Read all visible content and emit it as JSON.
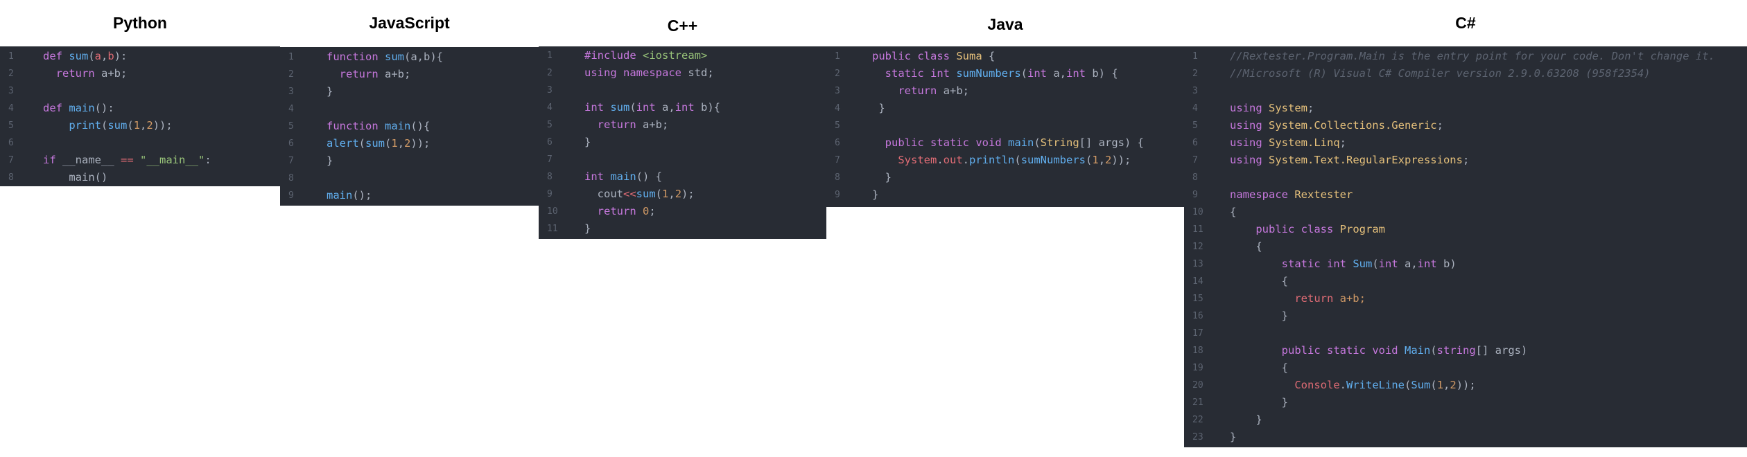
{
  "panels": [
    {
      "title": "Python",
      "lines": [
        {
          "n": "1",
          "tokens": [
            [
              "def ",
              "kw"
            ],
            [
              "sum",
              "fn"
            ],
            [
              "(",
              "pl"
            ],
            [
              "a",
              "var"
            ],
            [
              ",",
              "pl"
            ],
            [
              "b",
              "var"
            ],
            [
              "):",
              "pl"
            ]
          ]
        },
        {
          "n": "2",
          "tokens": [
            [
              "  return ",
              "kw"
            ],
            [
              "a+b;",
              "pl"
            ]
          ]
        },
        {
          "n": "3",
          "tokens": []
        },
        {
          "n": "4",
          "tokens": [
            [
              "def ",
              "kw"
            ],
            [
              "main",
              "fn"
            ],
            [
              "():",
              "pl"
            ]
          ]
        },
        {
          "n": "5",
          "tokens": [
            [
              "    ",
              "pl"
            ],
            [
              "print",
              "fn"
            ],
            [
              "(",
              "pl"
            ],
            [
              "sum",
              "fn"
            ],
            [
              "(",
              "pl"
            ],
            [
              "1",
              "num"
            ],
            [
              ",",
              "pl"
            ],
            [
              "2",
              "num"
            ],
            [
              "));",
              "pl"
            ]
          ]
        },
        {
          "n": "6",
          "tokens": []
        },
        {
          "n": "7",
          "tokens": [
            [
              "if ",
              "kw"
            ],
            [
              "__name__ ",
              "pl"
            ],
            [
              "== ",
              "var"
            ],
            [
              "\"__main__\"",
              "str"
            ],
            [
              ":",
              "pl"
            ]
          ]
        },
        {
          "n": "8",
          "tokens": [
            [
              "    main()",
              "pl"
            ]
          ]
        }
      ]
    },
    {
      "title": "JavaScript",
      "lines": [
        {
          "n": "1",
          "tokens": [
            [
              "function ",
              "kw"
            ],
            [
              "sum",
              "fn"
            ],
            [
              "(a,b){",
              "pl"
            ]
          ]
        },
        {
          "n": "2",
          "tokens": [
            [
              "  return ",
              "kw"
            ],
            [
              "a+b;",
              "pl"
            ]
          ]
        },
        {
          "n": "3",
          "tokens": [
            [
              "}",
              "pl"
            ]
          ]
        },
        {
          "n": "4",
          "tokens": []
        },
        {
          "n": "5",
          "tokens": [
            [
              "function ",
              "kw"
            ],
            [
              "main",
              "fn"
            ],
            [
              "(){",
              "pl"
            ]
          ]
        },
        {
          "n": "6",
          "tokens": [
            [
              "alert",
              "fn"
            ],
            [
              "(",
              "pl"
            ],
            [
              "sum",
              "fn"
            ],
            [
              "(",
              "pl"
            ],
            [
              "1",
              "num"
            ],
            [
              ",",
              "pl"
            ],
            [
              "2",
              "num"
            ],
            [
              "));",
              "pl"
            ]
          ]
        },
        {
          "n": "7",
          "tokens": [
            [
              "}",
              "pl"
            ]
          ]
        },
        {
          "n": "8",
          "tokens": []
        },
        {
          "n": "9",
          "tokens": [
            [
              "main",
              "fn"
            ],
            [
              "();",
              "pl"
            ]
          ]
        }
      ]
    },
    {
      "title": "C++",
      "lines": [
        {
          "n": "1",
          "tokens": [
            [
              "#include ",
              "kw"
            ],
            [
              "<iostream>",
              "str"
            ]
          ]
        },
        {
          "n": "2",
          "tokens": [
            [
              "using ",
              "kw"
            ],
            [
              "namespace ",
              "kw"
            ],
            [
              "std;",
              "pl"
            ]
          ]
        },
        {
          "n": "3",
          "tokens": []
        },
        {
          "n": "4",
          "tokens": [
            [
              "int ",
              "kw"
            ],
            [
              "sum",
              "fn"
            ],
            [
              "(",
              "pl"
            ],
            [
              "int ",
              "kw"
            ],
            [
              "a,",
              "pl"
            ],
            [
              "int ",
              "kw"
            ],
            [
              "b){",
              "pl"
            ]
          ]
        },
        {
          "n": "5",
          "tokens": [
            [
              "  return ",
              "kw"
            ],
            [
              "a+b;",
              "pl"
            ]
          ]
        },
        {
          "n": "6",
          "tokens": [
            [
              "}",
              "pl"
            ]
          ]
        },
        {
          "n": "7",
          "tokens": []
        },
        {
          "n": "8",
          "tokens": [
            [
              "int ",
              "kw"
            ],
            [
              "main",
              "fn"
            ],
            [
              "() {",
              "pl"
            ]
          ]
        },
        {
          "n": "9",
          "tokens": [
            [
              "  cout",
              "pl"
            ],
            [
              "<<",
              "var"
            ],
            [
              "sum",
              "fn"
            ],
            [
              "(",
              "pl"
            ],
            [
              "1",
              "num"
            ],
            [
              ",",
              "pl"
            ],
            [
              "2",
              "num"
            ],
            [
              ");",
              "pl"
            ]
          ]
        },
        {
          "n": "10",
          "tokens": [
            [
              "  return ",
              "kw"
            ],
            [
              "0",
              "num"
            ],
            [
              ";",
              "pl"
            ]
          ]
        },
        {
          "n": "11",
          "tokens": [
            [
              "}",
              "pl"
            ]
          ]
        }
      ]
    },
    {
      "title": "Java",
      "lines": [
        {
          "n": "1",
          "tokens": [
            [
              "public ",
              "kw"
            ],
            [
              "class ",
              "kw"
            ],
            [
              "Suma ",
              "cls"
            ],
            [
              "{",
              "pl"
            ]
          ]
        },
        {
          "n": "2",
          "tokens": [
            [
              "  static ",
              "kw"
            ],
            [
              "int ",
              "kw"
            ],
            [
              "sumNumbers",
              "fn"
            ],
            [
              "(",
              "pl"
            ],
            [
              "int ",
              "kw"
            ],
            [
              "a,",
              "pl"
            ],
            [
              "int ",
              "kw"
            ],
            [
              "b) {",
              "pl"
            ]
          ]
        },
        {
          "n": "3",
          "tokens": [
            [
              "    return ",
              "kw"
            ],
            [
              "a+b;",
              "pl"
            ]
          ]
        },
        {
          "n": "4",
          "tokens": [
            [
              " }",
              "pl"
            ]
          ]
        },
        {
          "n": "5",
          "tokens": []
        },
        {
          "n": "6",
          "tokens": [
            [
              "  public ",
              "kw"
            ],
            [
              "static ",
              "kw"
            ],
            [
              "void ",
              "kw"
            ],
            [
              "main",
              "fn"
            ],
            [
              "(",
              "pl"
            ],
            [
              "String",
              "cls"
            ],
            [
              "[] args) {",
              "pl"
            ]
          ]
        },
        {
          "n": "7",
          "tokens": [
            [
              "    ",
              "pl"
            ],
            [
              "System",
              "var"
            ],
            [
              ".",
              "pl"
            ],
            [
              "out",
              "var"
            ],
            [
              ".",
              "pl"
            ],
            [
              "println",
              "fn"
            ],
            [
              "(",
              "pl"
            ],
            [
              "sumNumbers",
              "fn"
            ],
            [
              "(",
              "pl"
            ],
            [
              "1",
              "num"
            ],
            [
              ",",
              "pl"
            ],
            [
              "2",
              "num"
            ],
            [
              "));",
              "pl"
            ]
          ]
        },
        {
          "n": "8",
          "tokens": [
            [
              "  }",
              "pl"
            ]
          ]
        },
        {
          "n": "9",
          "tokens": [
            [
              "}",
              "pl"
            ]
          ]
        }
      ]
    },
    {
      "title": "C#",
      "lines": [
        {
          "n": "1",
          "tokens": [
            [
              "//Rextester.Program.Main is the entry point for your code. Don't change it.",
              "cm"
            ]
          ]
        },
        {
          "n": "2",
          "tokens": [
            [
              "//Microsoft (R) Visual C# Compiler version 2.9.0.63208 (958f2354)",
              "cm"
            ]
          ]
        },
        {
          "n": "3",
          "tokens": []
        },
        {
          "n": "4",
          "tokens": [
            [
              "using ",
              "kw"
            ],
            [
              "System",
              "cls"
            ],
            [
              ";",
              "pl"
            ]
          ]
        },
        {
          "n": "5",
          "tokens": [
            [
              "using ",
              "kw"
            ],
            [
              "System.Collections.Generic",
              "cls"
            ],
            [
              ";",
              "pl"
            ]
          ]
        },
        {
          "n": "6",
          "tokens": [
            [
              "using ",
              "kw"
            ],
            [
              "System.Linq",
              "cls"
            ],
            [
              ";",
              "pl"
            ]
          ]
        },
        {
          "n": "7",
          "tokens": [
            [
              "using ",
              "kw"
            ],
            [
              "System.Text.RegularExpressions",
              "cls"
            ],
            [
              ";",
              "pl"
            ]
          ]
        },
        {
          "n": "8",
          "tokens": []
        },
        {
          "n": "9",
          "tokens": [
            [
              "namespace ",
              "kw"
            ],
            [
              "Rextester",
              "cls"
            ]
          ]
        },
        {
          "n": "10",
          "tokens": [
            [
              "{",
              "pl"
            ]
          ]
        },
        {
          "n": "11",
          "tokens": [
            [
              "    public ",
              "kw"
            ],
            [
              "class ",
              "kw"
            ],
            [
              "Program",
              "cls"
            ]
          ]
        },
        {
          "n": "12",
          "tokens": [
            [
              "    {",
              "pl"
            ]
          ]
        },
        {
          "n": "13",
          "tokens": [
            [
              "        static ",
              "kw"
            ],
            [
              "int ",
              "kw"
            ],
            [
              "Sum",
              "fn"
            ],
            [
              "(",
              "pl"
            ],
            [
              "int ",
              "kw"
            ],
            [
              "a,",
              "pl"
            ],
            [
              "int ",
              "kw"
            ],
            [
              "b)",
              "pl"
            ]
          ]
        },
        {
          "n": "14",
          "tokens": [
            [
              "        {",
              "pl"
            ]
          ]
        },
        {
          "n": "15",
          "tokens": [
            [
              "          return ",
              "var"
            ],
            [
              "a+b;",
              "num"
            ]
          ]
        },
        {
          "n": "16",
          "tokens": [
            [
              "        }",
              "pl"
            ]
          ]
        },
        {
          "n": "17",
          "tokens": []
        },
        {
          "n": "18",
          "tokens": [
            [
              "        public ",
              "kw"
            ],
            [
              "static ",
              "kw"
            ],
            [
              "void ",
              "kw"
            ],
            [
              "Main",
              "fn"
            ],
            [
              "(",
              "pl"
            ],
            [
              "string",
              "kw"
            ],
            [
              "[] args)",
              "pl"
            ]
          ]
        },
        {
          "n": "19",
          "tokens": [
            [
              "        {",
              "pl"
            ]
          ]
        },
        {
          "n": "20",
          "tokens": [
            [
              "          ",
              "pl"
            ],
            [
              "Console",
              "var"
            ],
            [
              ".",
              "pl"
            ],
            [
              "WriteLine",
              "fn"
            ],
            [
              "(",
              "pl"
            ],
            [
              "Sum",
              "fn"
            ],
            [
              "(",
              "pl"
            ],
            [
              "1",
              "num"
            ],
            [
              ",",
              "pl"
            ],
            [
              "2",
              "num"
            ],
            [
              "));",
              "pl"
            ]
          ]
        },
        {
          "n": "21",
          "tokens": [
            [
              "        }",
              "pl"
            ]
          ]
        },
        {
          "n": "22",
          "tokens": [
            [
              "    }",
              "pl"
            ]
          ]
        },
        {
          "n": "23",
          "tokens": [
            [
              "}",
              "pl"
            ]
          ]
        }
      ]
    }
  ]
}
